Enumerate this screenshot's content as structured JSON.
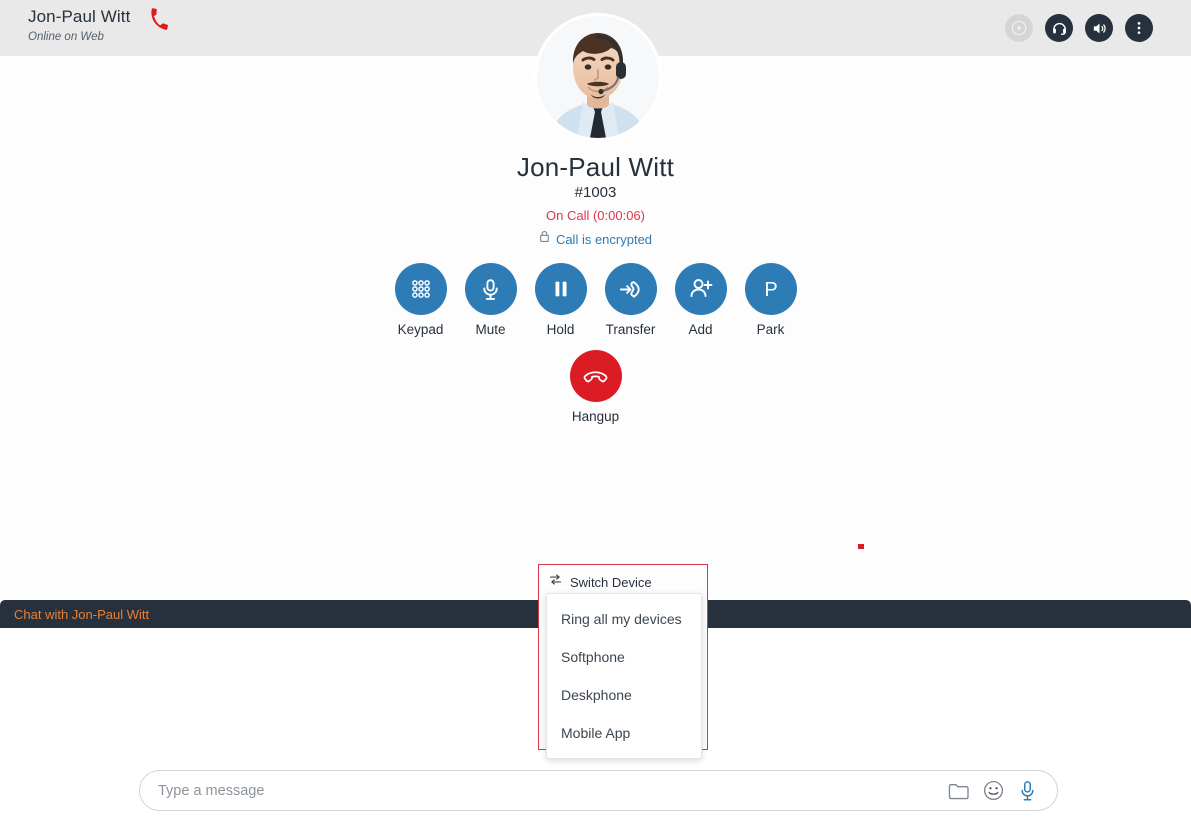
{
  "topbar": {
    "user_name": "Jon-Paul Witt",
    "user_status": "Online on Web",
    "phone_icon": "phone-handset-icon",
    "actions": [
      {
        "name": "record-button",
        "icon": "play-circle-icon",
        "state": "disabled"
      },
      {
        "name": "headset-button",
        "icon": "headset-icon",
        "state": "enabled"
      },
      {
        "name": "speaker-button",
        "icon": "speaker-icon",
        "state": "enabled"
      },
      {
        "name": "more-options-button",
        "icon": "dots-vertical-icon",
        "state": "enabled"
      }
    ]
  },
  "call": {
    "avatar_alt": "avatar-photo",
    "name": "Jon-Paul Witt",
    "extension": "#1003",
    "status": "On Call (0:00:06)",
    "encryption_label": "Call is encrypted",
    "encryption_icon": "lock-icon",
    "actions": [
      {
        "label": "Keypad",
        "icon": "keypad-icon"
      },
      {
        "label": "Mute",
        "icon": "microphone-icon"
      },
      {
        "label": "Hold",
        "icon": "pause-icon"
      },
      {
        "label": "Transfer",
        "icon": "transfer-call-icon"
      },
      {
        "label": "Add",
        "icon": "add-person-icon"
      },
      {
        "label": "Park",
        "icon": "park-p-icon"
      }
    ],
    "hangup": {
      "label": "Hangup",
      "icon": "hangup-phone-icon"
    }
  },
  "switch_device": {
    "title": "Switch Device",
    "icon": "swap-arrows-icon",
    "options": [
      "Ring all my devices",
      "Softphone",
      "Deskphone",
      "Mobile App"
    ]
  },
  "chat": {
    "header_title": "Chat with Jon-Paul Witt",
    "composer_placeholder": "Type a message",
    "composer_value": "",
    "composer_icons": [
      {
        "name": "attach-folder-icon"
      },
      {
        "name": "emoji-icon"
      },
      {
        "name": "voice-record-icon"
      }
    ]
  },
  "colors": {
    "accent_blue": "#2d7cb5",
    "danger_red": "#dc1c24",
    "status_red": "#d93a4b",
    "dark_navy": "#27313d",
    "chat_orange": "#ea8034",
    "header_gray": "#e9e9e9",
    "popover_border_red": "#d9384a"
  }
}
